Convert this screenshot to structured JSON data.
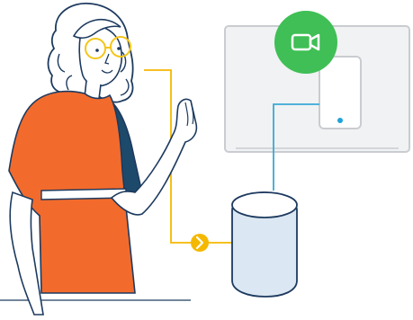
{
  "colors": {
    "outline": "#1d3a5f",
    "dress_orange": "#f26b2c",
    "dress_dark": "#1d4a6b",
    "glasses_yellow": "#f5c518",
    "cable_yellow": "#f5b800",
    "cable_blue": "#3aa9d6",
    "video_badge_green": "#3fbf55",
    "tv_frame": "#f1f2f3",
    "tv_border": "#c9ccd0",
    "speaker_fill": "#dbe7f2",
    "led_blue": "#1fa3d8",
    "white": "#ffffff"
  },
  "icons": {
    "video_badge": "video-camera-icon",
    "connector": "chevron-right-icon"
  }
}
